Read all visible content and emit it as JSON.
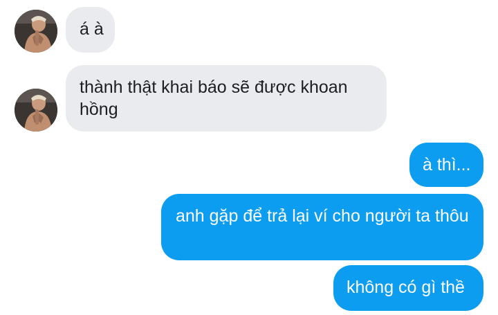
{
  "conversation": {
    "messages": [
      {
        "sender": "contact",
        "text": "á à"
      },
      {
        "sender": "contact",
        "text": "thành thật khai báo sẽ được khoan hồng"
      },
      {
        "sender": "self",
        "text": "à thì..."
      },
      {
        "sender": "self",
        "text": "anh gặp để trả lại ví cho người ta thôu"
      },
      {
        "sender": "self",
        "text": "không có gì thề"
      }
    ],
    "contact_avatar_icon": "profile-photo-icon"
  },
  "colors": {
    "incoming_bubble": "#e9ebee",
    "outgoing_bubble": "#0d9df0",
    "incoming_text": "#1c1e21",
    "outgoing_text": "#ffffff"
  }
}
